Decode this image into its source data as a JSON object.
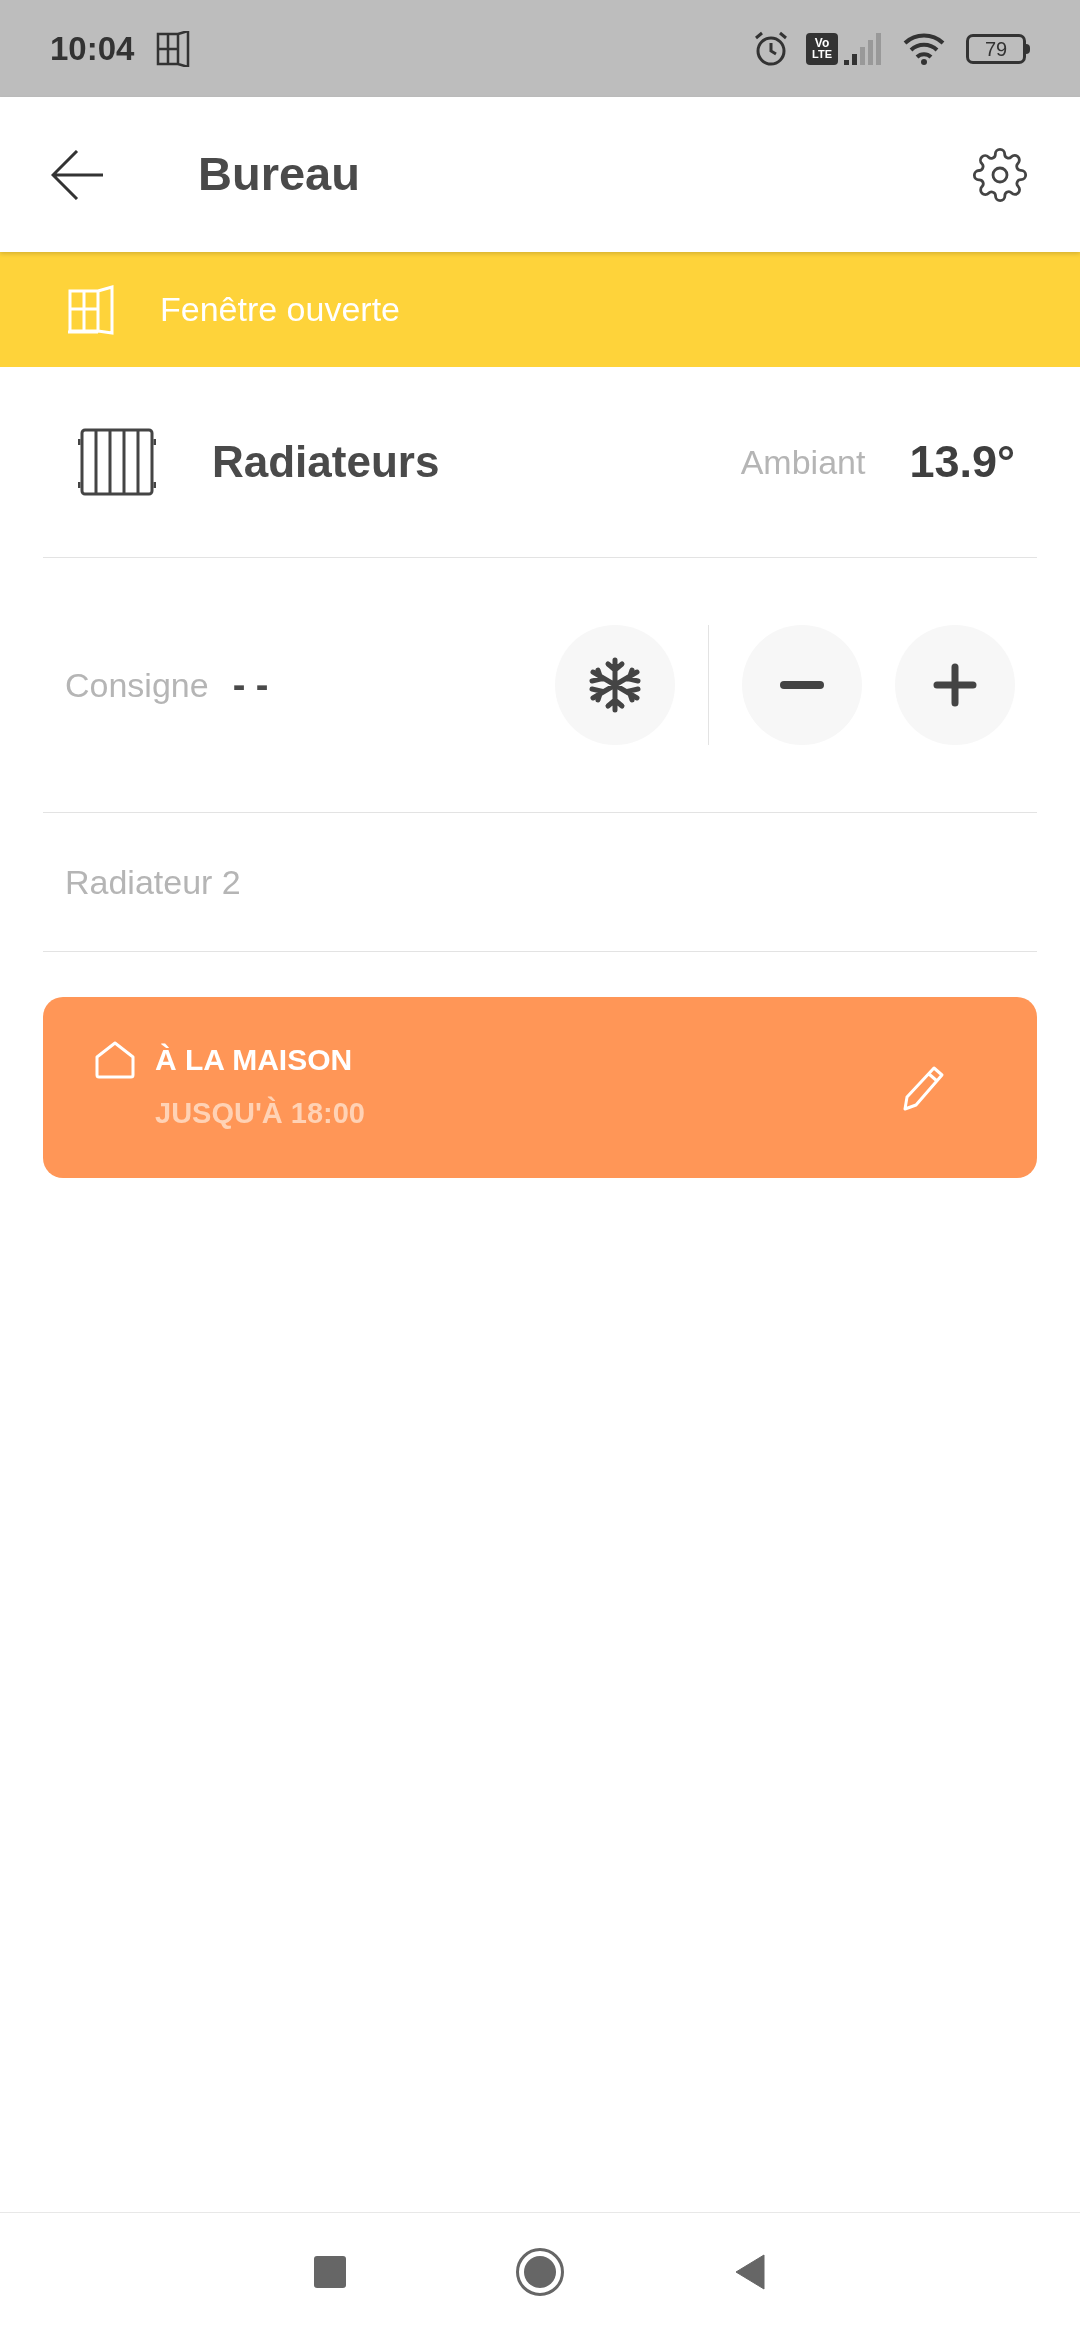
{
  "status_bar": {
    "time": "10:04",
    "battery": "79",
    "network_badge": [
      "Vo",
      "LTE"
    ]
  },
  "header": {
    "title": "Bureau"
  },
  "alert_banner": {
    "text": "Fenêtre ouverte"
  },
  "zone": {
    "name": "Radiateurs",
    "ambient_label": "Ambiant",
    "ambient_value": "13.9°"
  },
  "setpoint": {
    "label": "Consigne",
    "value": "- -"
  },
  "devices": [
    "Radiateur 2"
  ],
  "mode_card": {
    "title": "À LA MAISON",
    "subtitle": "JUSQU'À 18:00"
  }
}
